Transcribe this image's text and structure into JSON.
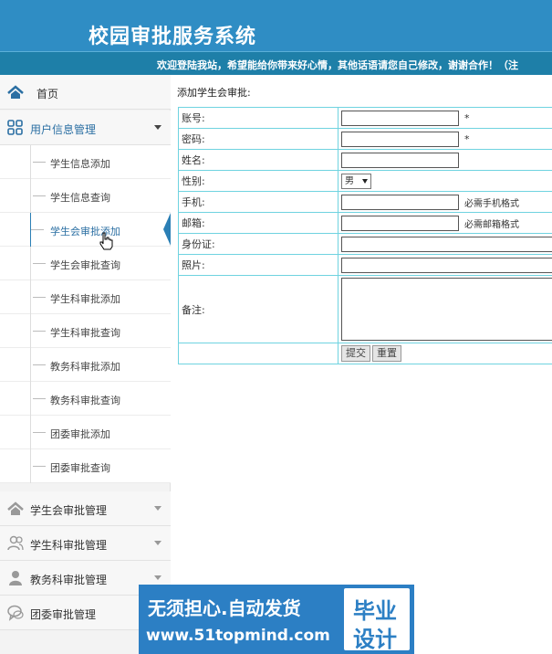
{
  "header": {
    "title": "校园审批服务系统",
    "ticker": "欢迎登陆我站，希望能给你带来好心情，其他话语请您自己修改，谢谢合作！（注"
  },
  "sidebar": {
    "home": "首页",
    "user_info": {
      "label": "用户信息管理",
      "items": [
        "学生信息添加",
        "学生信息查询",
        "学生会审批添加",
        "学生会审批查询",
        "学生科审批添加",
        "学生科审批查询",
        "教务科审批添加",
        "教务科审批查询",
        "团委审批添加",
        "团委审批查询"
      ]
    },
    "student_union_mgmt": "学生会审批管理",
    "student_section_mgmt": "学生科审批管理",
    "academic_mgmt": "教务科审批管理",
    "youth_league_mgmt": "团委审批管理"
  },
  "form": {
    "title": "添加学生会审批:",
    "labels": {
      "account": "账号:",
      "password": "密码:",
      "name": "姓名:",
      "gender": "性别:",
      "phone": "手机:",
      "email": "邮箱:",
      "id_card": "身份证:",
      "photo": "照片:",
      "remark": "备注:"
    },
    "required_mark": "*",
    "gender_selected": "男",
    "phone_hint": "必需手机格式",
    "email_hint": "必需邮箱格式",
    "submit": "提交",
    "reset": "重置"
  },
  "watermark": {
    "line1": "无须担心.自动发货",
    "line2": "www.51topmind.com",
    "badge1": "毕业",
    "badge2": "设计"
  }
}
